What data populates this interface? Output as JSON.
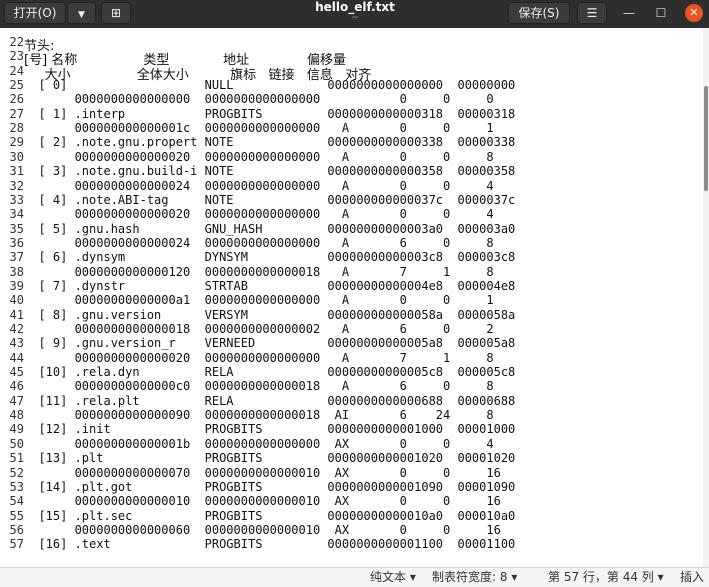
{
  "header": {
    "open_label": "打开(O)",
    "dropdown_icon": "▼",
    "newtab_icon": "⊞",
    "title": "hello_elf.txt",
    "subtitle": "~",
    "save_label": "保存(S)",
    "menu_icon": "☰",
    "minimize_icon": "—",
    "maximize_icon": "☐",
    "close_icon": "✕"
  },
  "editor": {
    "lines": [
      {
        "n": "22",
        "t": "节头:"
      },
      {
        "n": "23",
        "t": "[号] 名称                类型             地址              偏移量"
      },
      {
        "n": "24",
        "t": "     大小                全体大小          旗标   链接   信息   对齐"
      },
      {
        "n": "25",
        "t": "  [ 0]                   NULL             0000000000000000  00000000"
      },
      {
        "n": "26",
        "t": "       0000000000000000  0000000000000000           0     0     0"
      },
      {
        "n": "27",
        "t": "  [ 1] .interp           PROGBITS         0000000000000318  00000318"
      },
      {
        "n": "28",
        "t": "       000000000000001c  0000000000000000   A       0     0     1"
      },
      {
        "n": "29",
        "t": "  [ 2] .note.gnu.propert NOTE             0000000000000338  00000338"
      },
      {
        "n": "30",
        "t": "       0000000000000020  0000000000000000   A       0     0     8"
      },
      {
        "n": "31",
        "t": "  [ 3] .note.gnu.build-i NOTE             0000000000000358  00000358"
      },
      {
        "n": "32",
        "t": "       0000000000000024  0000000000000000   A       0     0     4"
      },
      {
        "n": "33",
        "t": "  [ 4] .note.ABI-tag     NOTE             000000000000037c  0000037c"
      },
      {
        "n": "34",
        "t": "       0000000000000020  0000000000000000   A       0     0     4"
      },
      {
        "n": "35",
        "t": "  [ 5] .gnu.hash         GNU_HASH         00000000000003a0  000003a0"
      },
      {
        "n": "36",
        "t": "       0000000000000024  0000000000000000   A       6     0     8"
      },
      {
        "n": "37",
        "t": "  [ 6] .dynsym           DYNSYM           00000000000003c8  000003c8"
      },
      {
        "n": "38",
        "t": "       0000000000000120  0000000000000018   A       7     1     8"
      },
      {
        "n": "39",
        "t": "  [ 7] .dynstr           STRTAB           00000000000004e8  000004e8"
      },
      {
        "n": "40",
        "t": "       00000000000000a1  0000000000000000   A       0     0     1"
      },
      {
        "n": "41",
        "t": "  [ 8] .gnu.version      VERSYM           000000000000058a  0000058a"
      },
      {
        "n": "42",
        "t": "       0000000000000018  0000000000000002   A       6     0     2"
      },
      {
        "n": "43",
        "t": "  [ 9] .gnu.version_r    VERNEED          00000000000005a8  000005a8"
      },
      {
        "n": "44",
        "t": "       0000000000000020  0000000000000000   A       7     1     8"
      },
      {
        "n": "45",
        "t": "  [10] .rela.dyn         RELA             00000000000005c8  000005c8"
      },
      {
        "n": "46",
        "t": "       00000000000000c0  0000000000000018   A       6     0     8"
      },
      {
        "n": "47",
        "t": "  [11] .rela.plt         RELA             0000000000000688  00000688"
      },
      {
        "n": "48",
        "t": "       0000000000000090  0000000000000018  AI       6    24     8"
      },
      {
        "n": "49",
        "t": "  [12] .init             PROGBITS         0000000000001000  00001000"
      },
      {
        "n": "50",
        "t": "       000000000000001b  0000000000000000  AX       0     0     4"
      },
      {
        "n": "51",
        "t": "  [13] .plt              PROGBITS         0000000000001020  00001020"
      },
      {
        "n": "52",
        "t": "       0000000000000070  0000000000000010  AX       0     0     16"
      },
      {
        "n": "53",
        "t": "  [14] .plt.got          PROGBITS         0000000000001090  00001090"
      },
      {
        "n": "54",
        "t": "       0000000000000010  0000000000000010  AX       0     0     16"
      },
      {
        "n": "55",
        "t": "  [15] .plt.sec          PROGBITS         00000000000010a0  000010a0"
      },
      {
        "n": "56",
        "t": "       0000000000000060  0000000000000010  AX       0     0     16"
      },
      {
        "n": "57",
        "t": "  [16] .text             PROGBITS         0000000000001100  00001100"
      }
    ]
  },
  "status": {
    "language": "纯文本",
    "tab_width": "制表符宽度: 8",
    "position": "第 57 行，第 44 列",
    "mode": "插入",
    "dropdown_icon": "▾"
  }
}
